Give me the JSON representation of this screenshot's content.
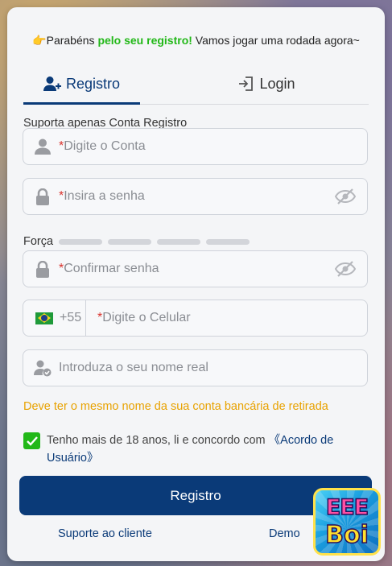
{
  "congrats": {
    "emoji": "👉",
    "prefix": "Parabéns ",
    "highlight": "pelo seu registro!",
    "suffix": " Vamos jogar uma rodada agora~"
  },
  "tabs": [
    {
      "label": "Registro",
      "icon": "user-plus-icon",
      "active": true
    },
    {
      "label": "Login",
      "icon": "login-door-icon",
      "active": false
    }
  ],
  "hint": "Suporta apenas Conta Registro",
  "fields": {
    "account": {
      "required": "*",
      "placeholder": "Digite o Conta",
      "icon": "user-icon"
    },
    "password": {
      "required": "*",
      "placeholder": "Insira a senha",
      "icon": "lock-icon"
    },
    "confirm": {
      "required": "*",
      "placeholder": "Confirmar senha",
      "icon": "lock-icon"
    },
    "phone": {
      "country_code": "+55",
      "required": "*",
      "placeholder": "Digite o Celular",
      "flag": "brazil-flag-icon"
    },
    "real_name": {
      "placeholder": "Introduza o seu nome real",
      "icon": "user-check-icon"
    }
  },
  "strength": {
    "label": "Força",
    "level": 0,
    "segments": 4
  },
  "warning": "Deve ter o mesmo nome da sua conta bancária de retirada",
  "agreement": {
    "checked": true,
    "text": "Tenho mais de 18 anos, li e concordo com ",
    "link": "《Acordo de Usuário》"
  },
  "submit_label": "Registro",
  "footer": {
    "support": "Suporte ao cliente",
    "demo": "Demo"
  },
  "logo": {
    "line1": "EEE",
    "line2": "Boi"
  },
  "colors": {
    "primary": "#0a3a78",
    "accent_green": "#22b818",
    "warning": "#e8a200",
    "required": "#d9332d"
  }
}
